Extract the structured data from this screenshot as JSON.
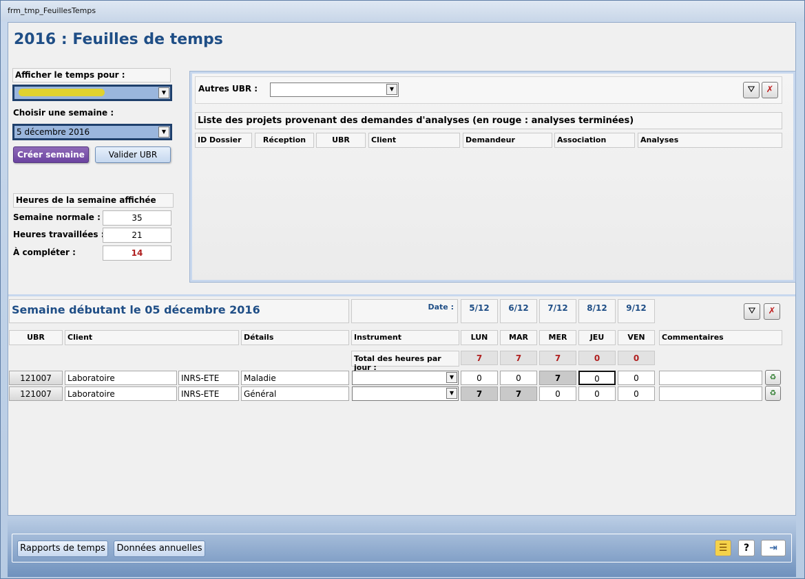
{
  "window": {
    "title": "frm_tmp_FeuillesTemps"
  },
  "page": {
    "title": "2016 : Feuilles de temps"
  },
  "left": {
    "afficher_label": "Afficher le temps pour :",
    "afficher_value": "",
    "semaine_label": "Choisir une semaine :",
    "semaine_value": "5 décembre 2016",
    "creer_button": "Créer semaine",
    "valider_button": "Valider UBR",
    "heures_header": "Heures de la semaine affichée",
    "normale_label": "Semaine normale :",
    "normale_value": "35",
    "travaillees_label": "Heures travaillées :",
    "travaillees_value": "21",
    "completer_label": "À compléter :",
    "completer_value": "14"
  },
  "projects": {
    "autres_label": "Autres UBR :",
    "autres_value": "",
    "list_title": "Liste des projets provenant des demandes d'analyses (en rouge : analyses terminées)",
    "columns": [
      "ID Dossier",
      "Réception",
      "UBR",
      "Client",
      "Demandeur",
      "Association",
      "Analyses"
    ]
  },
  "week": {
    "title": "Semaine débutant le 05 décembre 2016",
    "date_label": "Date :",
    "dates": [
      "5/12",
      "6/12",
      "7/12",
      "8/12",
      "9/12"
    ],
    "columns": {
      "ubr": "UBR",
      "client": "Client",
      "details": "Détails",
      "instrument": "Instrument",
      "days": [
        "LUN",
        "MAR",
        "MER",
        "JEU",
        "VEN"
      ],
      "commentaires": "Commentaires"
    },
    "total_label": "Total des heures par jour :",
    "totals": [
      "7",
      "7",
      "7",
      "0",
      "0"
    ],
    "rows": [
      {
        "ubr": "121007",
        "client": "Laboratoire",
        "org": "INRS-ETE",
        "details": "Maladie",
        "instrument": "",
        "hours": [
          "0",
          "0",
          "7",
          "0",
          "0"
        ],
        "commentaire": ""
      },
      {
        "ubr": "121007",
        "client": "Laboratoire",
        "org": "INRS-ETE",
        "details": "Général",
        "instrument": "",
        "hours": [
          "7",
          "7",
          "0",
          "0",
          "0"
        ],
        "commentaire": ""
      }
    ]
  },
  "footer": {
    "rapports_button": "Rapports de temps",
    "donnees_button": "Données annuelles",
    "help_label": "?"
  },
  "icons": {
    "filter": "filter-icon",
    "clear_filter": "clear-filter-icon",
    "delete_row": "recycle-bin-icon",
    "feedback": "speech-bubble-icon",
    "exit": "exit-door-icon"
  },
  "colors": {
    "title_blue": "#1f4e86",
    "combo_fill": "#9ab6dd",
    "purple_button": "#6b43a0",
    "red_value": "#b02020"
  }
}
